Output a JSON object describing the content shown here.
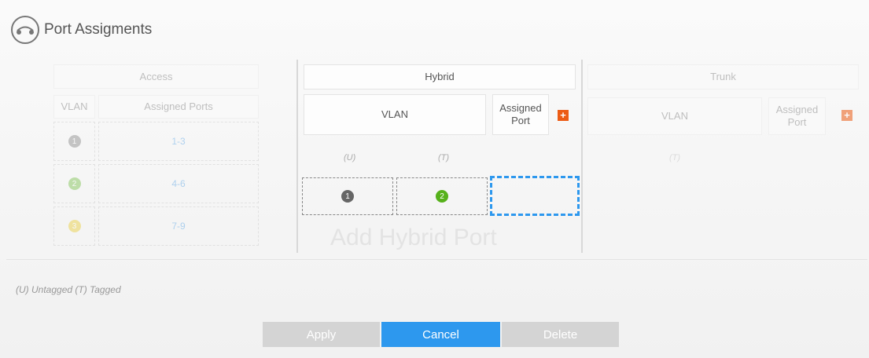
{
  "page_title": "Port Assigments",
  "icon_name": "network-port-icon",
  "access": {
    "header": "Access",
    "col_vlan": "VLAN",
    "col_ports": "Assigned Ports",
    "rows": [
      {
        "vlan": "1",
        "ports": "1-3",
        "color": "#666666"
      },
      {
        "vlan": "2",
        "ports": "4-6",
        "color": "#56b11b"
      },
      {
        "vlan": "3",
        "ports": "7-9",
        "color": "#e6c300"
      }
    ]
  },
  "hybrid": {
    "header": "Hybrid",
    "col_vlan": "VLAN",
    "col_port": "Assigned\nPort",
    "untagged_label": "(U)",
    "tagged_label": "(T)",
    "untagged_vlan": "1",
    "tagged_vlan": "2",
    "add_label": "Add Hybrid Port"
  },
  "trunk": {
    "header": "Trunk",
    "col_vlan": "VLAN",
    "col_port": "Assigned\nPort",
    "tagged_label": "(T)"
  },
  "legend": "(U) Untagged (T) Tagged",
  "buttons": {
    "apply": "Apply",
    "cancel": "Cancel",
    "delete": "Delete"
  },
  "colors": {
    "accent": "#2d98ee",
    "add": "#ec5b14"
  }
}
